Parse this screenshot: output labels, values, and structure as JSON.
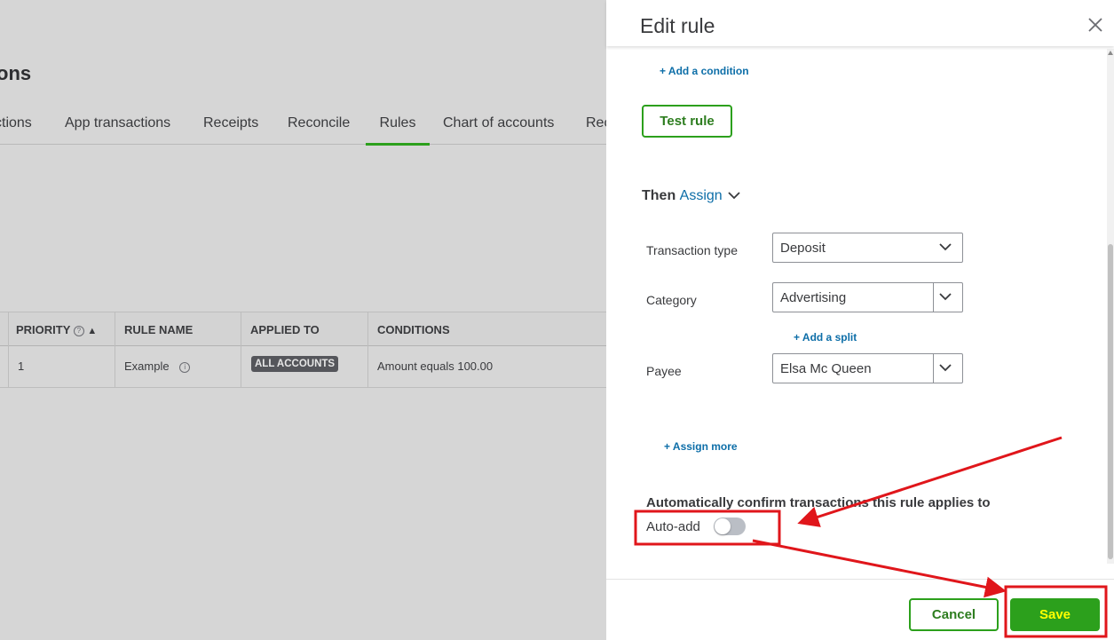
{
  "background": {
    "page_title": "ons",
    "tabs": [
      "ctions",
      "App transactions",
      "Receipts",
      "Reconcile",
      "Rules",
      "Chart of accounts",
      "Rec"
    ],
    "active_tab": "Rules",
    "table": {
      "headers": [
        "PRIORITY",
        "RULE NAME",
        "APPLIED TO",
        "CONDITIONS"
      ],
      "rows": [
        {
          "priority": "1",
          "rule_name": "Example",
          "applied_to": "ALL ACCOUNTS",
          "conditions": "Amount equals 100.00"
        }
      ]
    }
  },
  "panel": {
    "title": "Edit rule",
    "add_condition": "+ Add a condition",
    "test_rule": "Test rule",
    "then_label": "Then",
    "then_action": "Assign",
    "fields": {
      "transaction_type": {
        "label": "Transaction type",
        "value": "Deposit"
      },
      "category": {
        "label": "Category",
        "value": "Advertising"
      },
      "payee": {
        "label": "Payee",
        "value": "Elsa Mc Queen"
      }
    },
    "add_split": "+ Add a split",
    "assign_more": "+ Assign more",
    "auto_confirm_heading": "Automatically confirm transactions this rule applies to",
    "auto_add_label": "Auto-add",
    "auto_add_on": false,
    "cancel": "Cancel",
    "save": "Save"
  },
  "colors": {
    "accent_green": "#2ca01c",
    "link_blue": "#0d6ea8",
    "annotation_red": "#e0161b",
    "highlight_yellow": "#ffff00"
  }
}
